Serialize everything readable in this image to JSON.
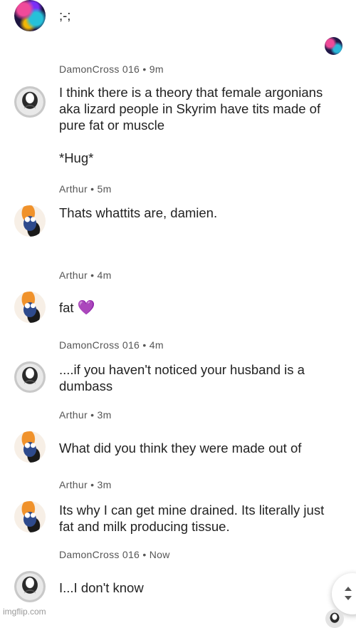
{
  "top_message": {
    "text": ";-;"
  },
  "comments": [
    {
      "author": "DamonCross 016",
      "time": "9m",
      "text": "I think there is a theory that female argonians\naka lizard people in Skyrim have tits made of\npure fat or muscle\n\n*Hug*"
    },
    {
      "author": "Arthur",
      "time": "5m",
      "text": "Thats whattits are, damien."
    },
    {
      "author": "Arthur",
      "time": "4m",
      "text": "fat",
      "emoji": "💜"
    },
    {
      "author": "DamonCross 016",
      "time": "4m",
      "text": "....if you haven't noticed your husband is a\ndumbass"
    },
    {
      "author": "Arthur",
      "time": "3m",
      "text": "What did you think they were made out of"
    },
    {
      "author": "Arthur",
      "time": "3m",
      "text": "Its why I can get mine drained. Its literally just\nfat and milk producing tissue."
    },
    {
      "author": "DamonCross 016",
      "time": "Now",
      "text": "I...I don't know"
    }
  ],
  "separator": "•",
  "watermark": "imgflip.com",
  "colors": {
    "heart": "#a64bf4",
    "meta": "#555555",
    "text": "#222222"
  }
}
